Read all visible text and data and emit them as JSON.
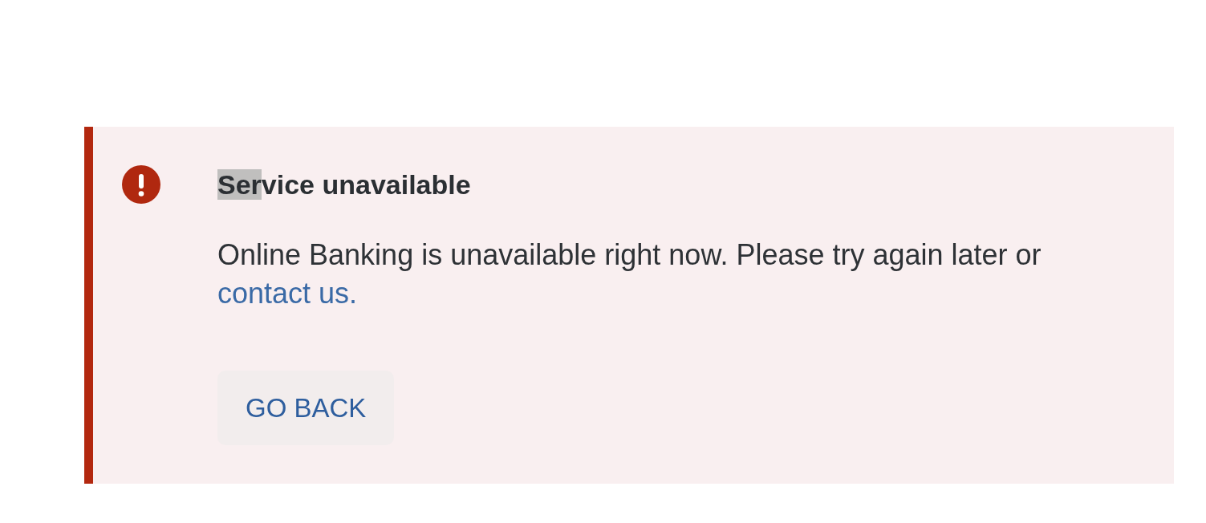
{
  "alert": {
    "kind": "error",
    "title": [
      {
        "text": "Ser",
        "highlighted": true
      },
      {
        "text": "vice unavailable",
        "highlighted": false
      }
    ],
    "message": {
      "text": "Online Banking is unavailable right now. Please try again later or",
      "link": "contact us."
    },
    "button": {
      "label": "GO BACK"
    }
  }
}
